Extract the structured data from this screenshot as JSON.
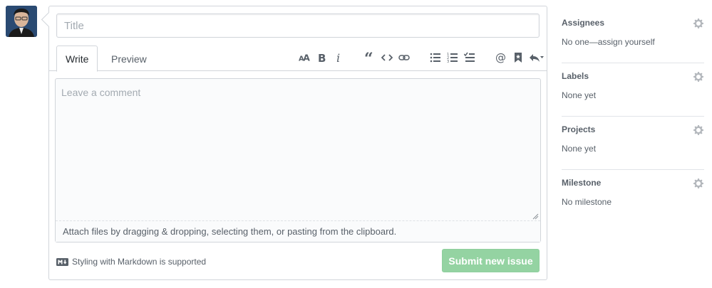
{
  "composer": {
    "title_placeholder": "Title",
    "tabs": [
      {
        "label": "Write",
        "selected": true
      },
      {
        "label": "Preview",
        "selected": false
      }
    ],
    "comment_placeholder": "Leave a comment",
    "drag_hint": "Attach files by dragging & dropping, selecting them, or pasting from the clipboard.",
    "markdown_hint": "Styling with Markdown is supported",
    "submit_label": "Submit new issue"
  },
  "toolbar": {
    "icons": [
      "text-size-icon",
      "bold-icon",
      "italic-icon",
      "quote-icon",
      "code-icon",
      "link-icon",
      "bulleted-list-icon",
      "numbered-list-icon",
      "task-list-icon",
      "mention-icon",
      "bookmark-icon",
      "reply-icon"
    ]
  },
  "sidebar": {
    "sections": [
      {
        "heading": "Assignees",
        "value": "No one—assign yourself"
      },
      {
        "heading": "Labels",
        "value": "None yet"
      },
      {
        "heading": "Projects",
        "value": "None yet"
      },
      {
        "heading": "Milestone",
        "value": "No milestone"
      }
    ]
  },
  "colors": {
    "submit_disabled": "#94d3a2",
    "border": "#d1d5da",
    "muted_text": "#586069"
  }
}
